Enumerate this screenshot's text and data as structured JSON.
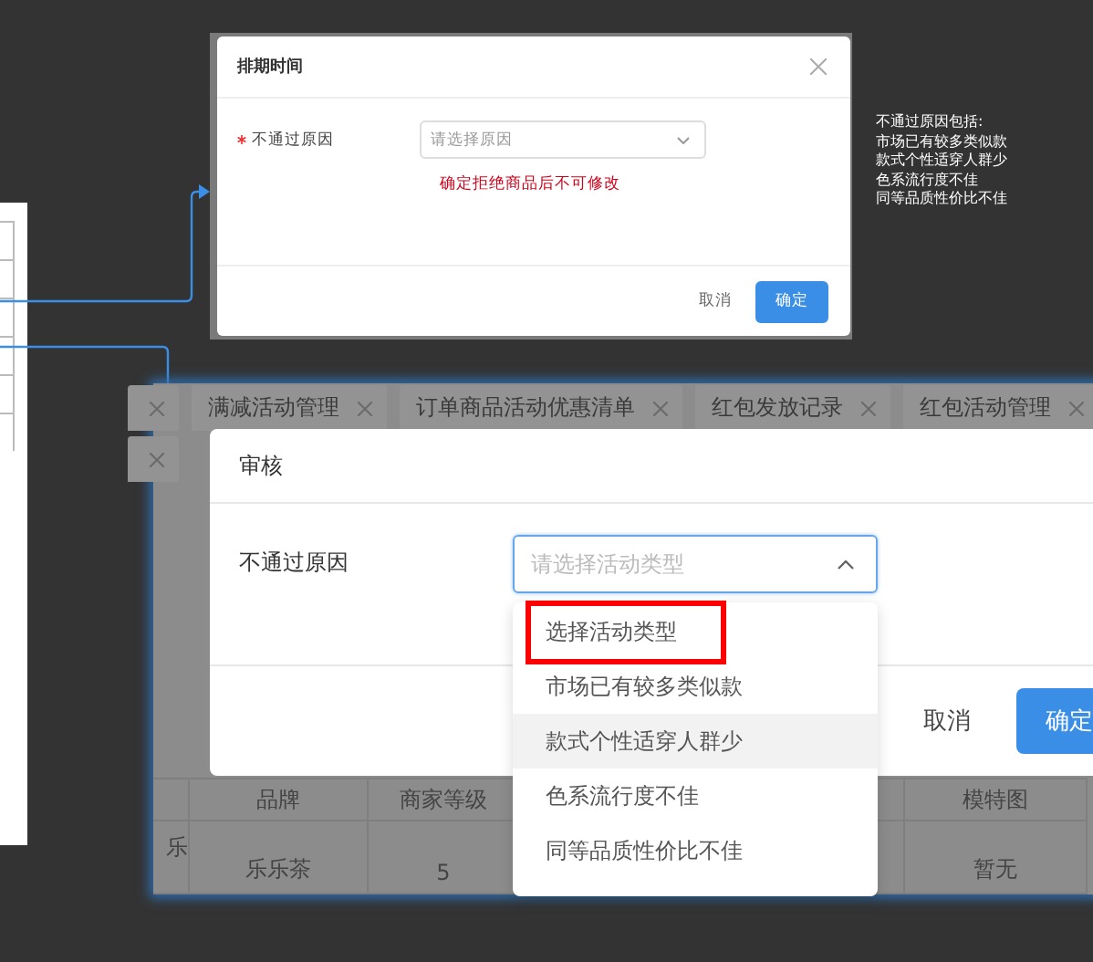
{
  "top_dialog": {
    "title": "排期时间",
    "field": {
      "required": true,
      "label": "不通过原因",
      "placeholder": "请选择原因"
    },
    "warning": "确定拒绝商品后不可修改",
    "buttons": [
      {
        "label": "取消",
        "primary": false
      },
      {
        "label": "确定",
        "primary": true
      }
    ]
  },
  "note": {
    "heading": "不通过原因包括:",
    "items": [
      "市场已有较多类似款",
      "款式个性适穿人群少",
      "色系流行度不佳",
      "同等品质性价比不佳"
    ]
  },
  "app_frame": {
    "tabs": [
      {
        "label": "满减活动管理"
      },
      {
        "label": "订单商品活动优惠清单"
      },
      {
        "label": "红包发放记录"
      },
      {
        "label": "红包活动管理"
      }
    ],
    "table": {
      "columns": [
        "品牌",
        "商家等级",
        "模特图"
      ],
      "row": {
        "cut_cell": "乐",
        "cells": [
          "乐乐茶",
          "5",
          "暂无"
        ]
      }
    }
  },
  "review_dialog": {
    "title": "审核",
    "field": {
      "label": "不通过原因",
      "placeholder": "请选择活动类型",
      "open": true
    },
    "options": [
      {
        "label": "选择活动类型",
        "hovered": false,
        "outlined": true
      },
      {
        "label": "市场已有较多类似款",
        "hovered": false,
        "outlined": false
      },
      {
        "label": "款式个性适穿人群少",
        "hovered": true,
        "outlined": false
      },
      {
        "label": "色系流行度不佳",
        "hovered": false,
        "outlined": false
      },
      {
        "label": "同等品质性价比不佳",
        "hovered": false,
        "outlined": false
      }
    ],
    "buttons": [
      {
        "label": "取消",
        "primary": false
      },
      {
        "label": "确定",
        "primary": true
      }
    ]
  }
}
